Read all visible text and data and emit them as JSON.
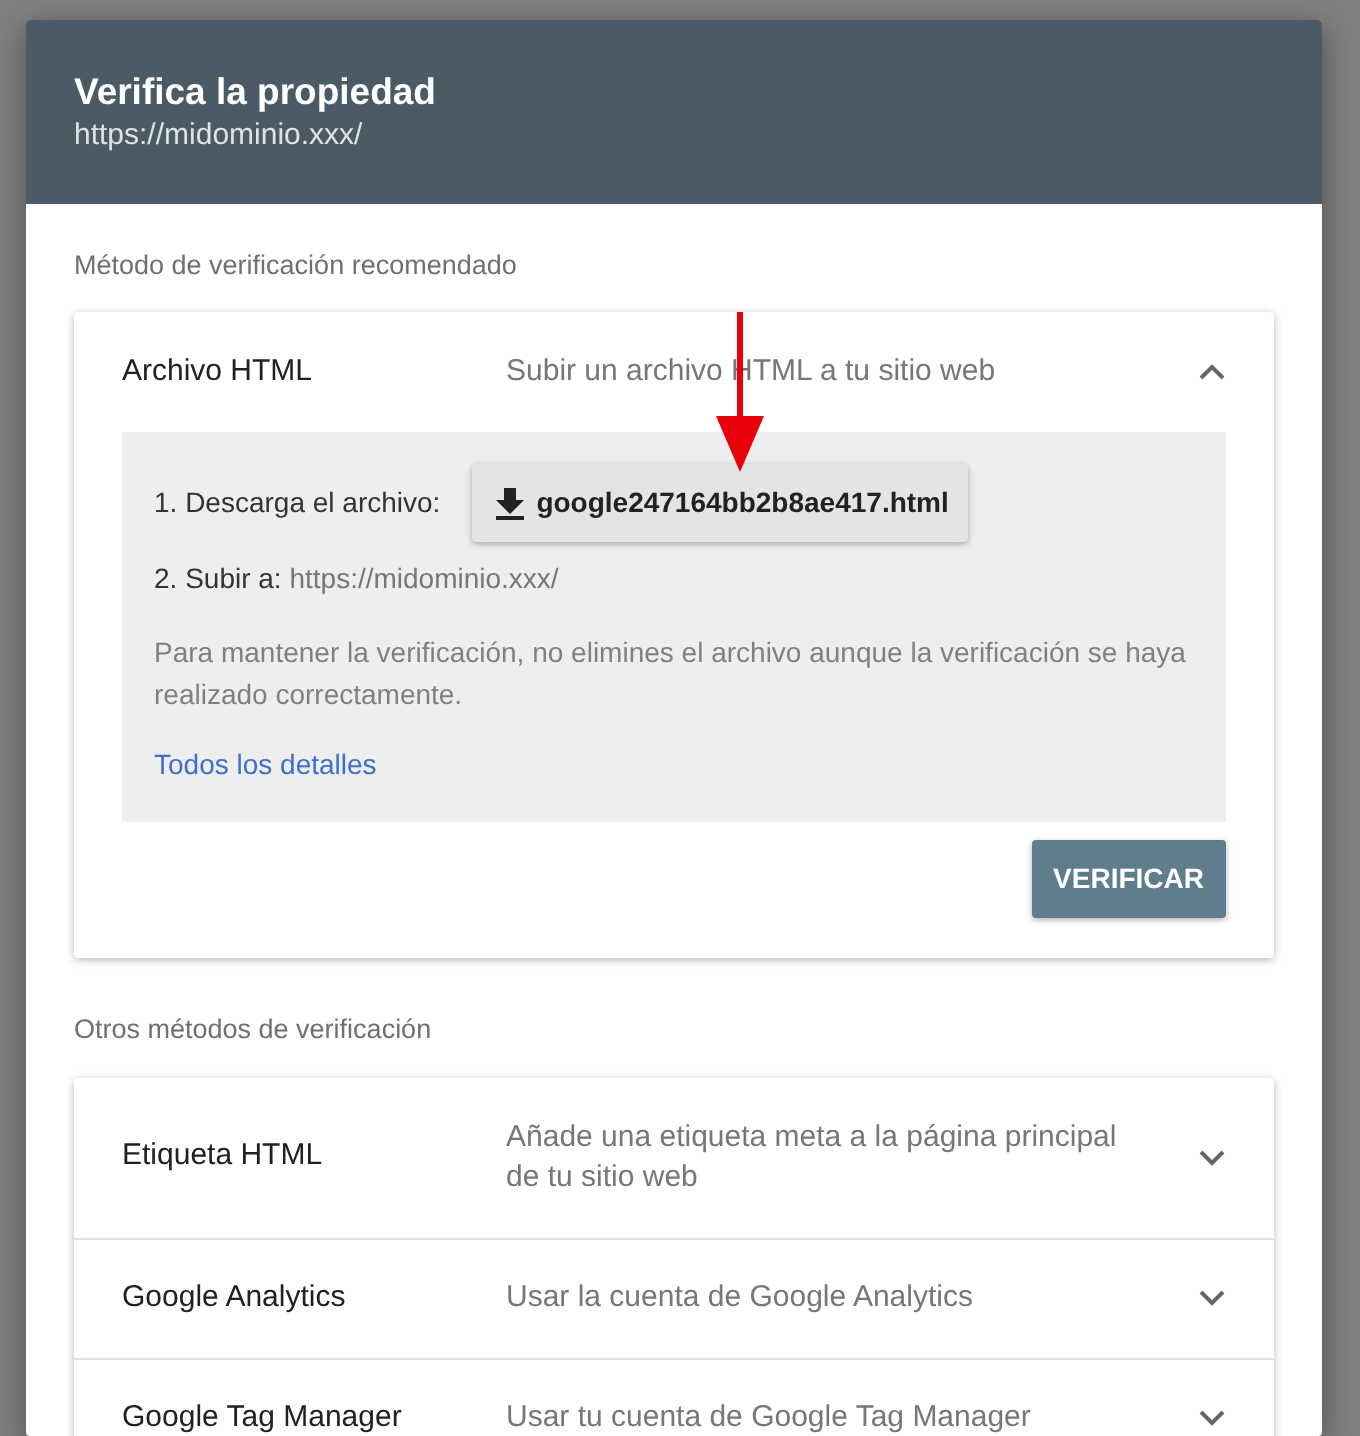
{
  "dialog": {
    "title": "Verifica la propiedad",
    "url": "https://midominio.xxx/"
  },
  "recommended": {
    "heading": "Método de verificación recomendado",
    "methods": [
      {
        "name": "Archivo HTML",
        "description": "Subir un archivo HTML a tu sitio web",
        "expanded": true,
        "details": {
          "step_1_label": "1. Descarga el archivo:",
          "download_button": "google247164bb2b8ae417.html",
          "step_2_label": "2. Subir a:",
          "step_2_url": "https://midominio.xxx/",
          "note": "Para mantener la verificación, no elimines el archivo aunque la verificación se haya realizado correctamente.",
          "link": "Todos los detalles",
          "verify_button": "VERIFICAR"
        }
      }
    ]
  },
  "others": {
    "heading": "Otros métodos de verificación",
    "methods": [
      {
        "name": "Etiqueta HTML",
        "description": "Añade una etiqueta meta a la página principal de tu sitio web",
        "expanded": false
      },
      {
        "name": "Google Analytics",
        "description": "Usar la cuenta de Google Analytics",
        "expanded": false
      },
      {
        "name": "Google Tag Manager",
        "description": "Usar tu cuenta de Google Tag Manager",
        "expanded": false
      }
    ]
  }
}
